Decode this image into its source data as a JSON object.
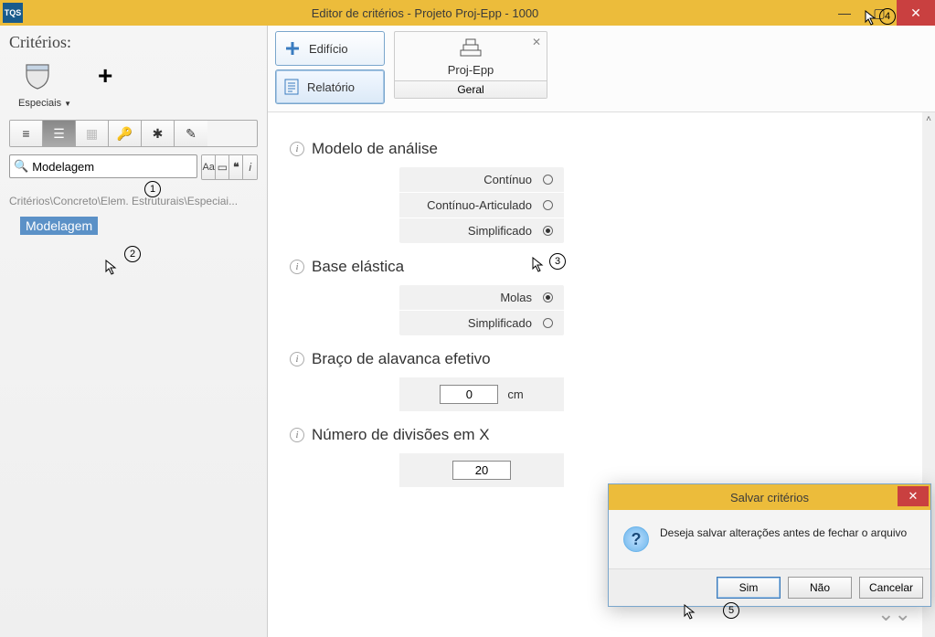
{
  "window": {
    "title": "Editor de critérios - Projeto Proj-Epp - 1000",
    "app_icon": "TQS"
  },
  "sidebar": {
    "title": "Critérios:",
    "especiais": "Especiais",
    "search_value": "Modelagem",
    "breadcrumb": "Critérios\\Concreto\\Elem. Estruturais\\Especiai...",
    "tree_selected": "Modelagem"
  },
  "tabs": {
    "edificio": "Edifício",
    "relatorio": "Relatório"
  },
  "project": {
    "name": "Proj-Epp",
    "sub": "Geral"
  },
  "sections": {
    "modelo": {
      "title": "Modelo de análise",
      "opts": [
        "Contínuo",
        "Contínuo-Articulado",
        "Simplificado"
      ],
      "selected": 2
    },
    "base": {
      "title": "Base elástica",
      "opts": [
        "Molas",
        "Simplificado"
      ],
      "selected": 0
    },
    "braco": {
      "title": "Braço de alavanca efetivo",
      "value": "0",
      "unit": "cm"
    },
    "divx": {
      "title": "Número de divisões em X",
      "value": "20"
    }
  },
  "dialog": {
    "title": "Salvar critérios",
    "msg": "Deseja salvar alterações antes de fechar o arquivo",
    "yes": "Sim",
    "no": "Não",
    "cancel": "Cancelar"
  },
  "annot": {
    "n1": "1",
    "n2": "2",
    "n3": "3",
    "n4": "4",
    "n5": "5"
  }
}
